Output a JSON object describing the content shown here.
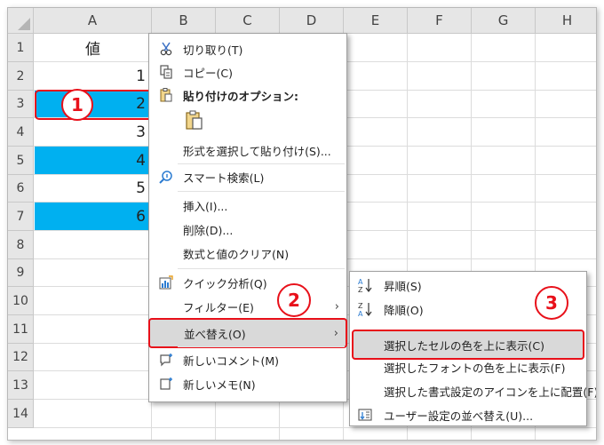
{
  "sheet": {
    "columns": [
      "A",
      "B",
      "C",
      "D",
      "E",
      "F",
      "G",
      "H"
    ],
    "rows": [
      "1",
      "2",
      "3",
      "4",
      "5",
      "6",
      "7",
      "8",
      "9",
      "10",
      "11",
      "12",
      "13",
      "14"
    ],
    "header_cell": "値",
    "values": [
      "1",
      "2",
      "3",
      "4",
      "5",
      "6"
    ],
    "highlight_color": "#00b0f0"
  },
  "context_menu": {
    "cut": "切り取り(T)",
    "copy": "コピー(C)",
    "paste_options": "貼り付けのオプション:",
    "paste_special": "形式を選択して貼り付け(S)...",
    "smart_lookup": "スマート検索(L)",
    "insert": "挿入(I)...",
    "delete": "削除(D)...",
    "clear": "数式と値のクリア(N)",
    "quick_analysis": "クイック分析(Q)",
    "filter": "フィルター(E)",
    "sort": "並べ替え(O)",
    "new_comment": "新しいコメント(M)",
    "new_note": "新しいメモ(N)"
  },
  "sort_submenu": {
    "asc": "昇順(S)",
    "desc": "降順(O)",
    "cell_color_top": "選択したセルの色を上に表示(C)",
    "font_color_top": "選択したフォントの色を上に表示(F)",
    "icon_top": "選択した書式設定のアイコンを上に配置(F)",
    "custom": "ユーザー設定の並べ替え(U)..."
  },
  "annotations": {
    "badge1": "1",
    "badge2": "2",
    "badge3": "3",
    "accent": "#e8101a"
  },
  "icons": {
    "cut": "scissors-icon",
    "copy": "copy-icon",
    "paste": "clipboard-icon",
    "smart_lookup": "search-info-icon",
    "quick_analysis": "quick-analysis-icon",
    "new_comment": "new-comment-icon",
    "new_note": "new-note-icon",
    "sort_asc": "sort-az-icon",
    "sort_desc": "sort-za-icon",
    "custom_sort": "custom-sort-icon"
  }
}
